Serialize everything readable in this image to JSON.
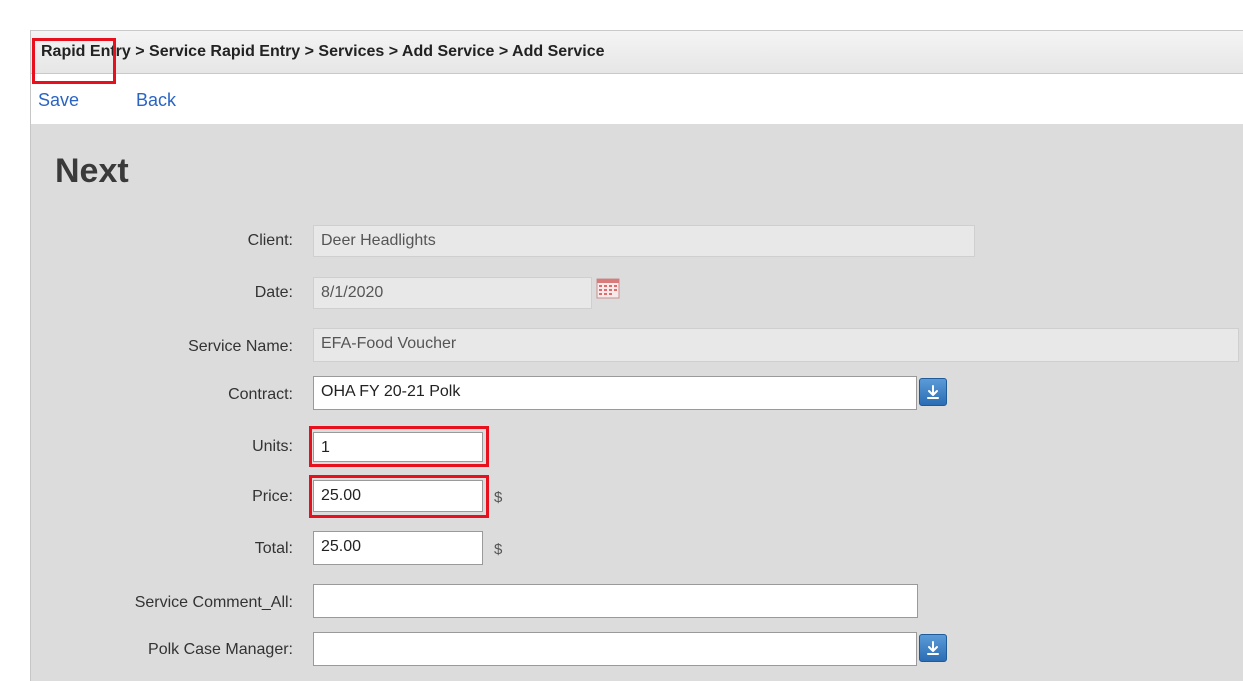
{
  "breadcrumb": "Rapid Entry > Service Rapid Entry > Services > Add Service > Add Service",
  "toolbar": {
    "save_label": "Save",
    "back_label": "Back"
  },
  "page_title": "Next",
  "form": {
    "client": {
      "label": "Client:",
      "value": "Deer Headlights"
    },
    "date": {
      "label": "Date:",
      "value": "8/1/2020",
      "icon": "calendar-icon"
    },
    "service_name": {
      "label": "Service Name:",
      "value": "EFA-Food Voucher"
    },
    "contract": {
      "label": "Contract:",
      "value": "OHA FY 20-21 Polk",
      "icon": "dropdown-arrow-icon"
    },
    "units": {
      "label": "Units:",
      "value": "1"
    },
    "price": {
      "label": "Price:",
      "value": "25.00",
      "unit": "$"
    },
    "total": {
      "label": "Total:",
      "value": "25.00",
      "unit": "$"
    },
    "service_comment": {
      "label": "Service Comment_All:",
      "value": ""
    },
    "case_manager": {
      "label": "Polk Case Manager:",
      "value": "",
      "icon": "dropdown-arrow-icon"
    }
  },
  "colors": {
    "link": "#2a64c4",
    "highlight": "#e8101c",
    "dropdown": "#2b6db4"
  }
}
